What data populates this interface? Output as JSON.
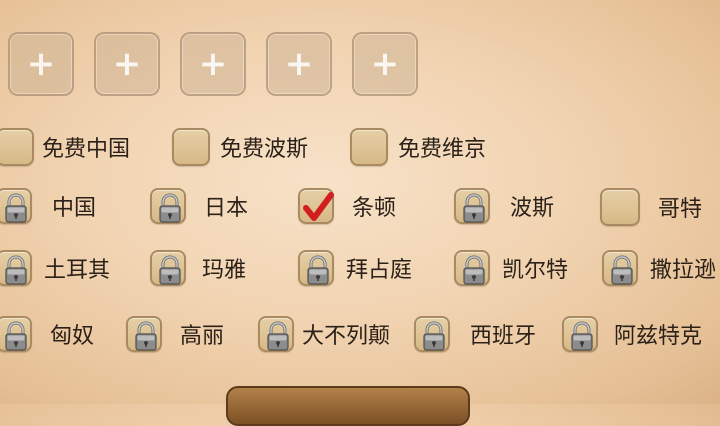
{
  "slots": [
    {
      "icon": "plus-icon",
      "label": "+"
    },
    {
      "icon": "plus-icon",
      "label": "+"
    },
    {
      "icon": "plus-icon",
      "label": "+"
    },
    {
      "icon": "plus-icon",
      "label": "+"
    },
    {
      "icon": "plus-icon",
      "label": "+"
    }
  ],
  "free_options": [
    {
      "label": "免费中国",
      "checked": false
    },
    {
      "label": "免费波斯",
      "checked": false
    },
    {
      "label": "免费维京",
      "checked": false
    }
  ],
  "civilizations": [
    [
      {
        "label": "中国",
        "state": "locked"
      },
      {
        "label": "日本",
        "state": "locked"
      },
      {
        "label": "条顿",
        "state": "checked"
      },
      {
        "label": "波斯",
        "state": "locked"
      },
      {
        "label": "哥特",
        "state": "unchecked"
      }
    ],
    [
      {
        "label": "土耳其",
        "state": "locked"
      },
      {
        "label": "玛雅",
        "state": "locked"
      },
      {
        "label": "拜占庭",
        "state": "locked"
      },
      {
        "label": "凯尔特",
        "state": "locked"
      },
      {
        "label": "撒拉逊",
        "state": "locked"
      }
    ],
    [
      {
        "label": "匈奴",
        "state": "locked"
      },
      {
        "label": "高丽",
        "state": "locked"
      },
      {
        "label": "大不列颠",
        "state": "locked"
      },
      {
        "label": "西班牙",
        "state": "locked"
      },
      {
        "label": "阿兹特克",
        "state": "locked"
      }
    ]
  ],
  "colors": {
    "checkmark": "#d11f1f",
    "box_fill": "#ddc396",
    "lock_body": "#8c8c8c"
  }
}
